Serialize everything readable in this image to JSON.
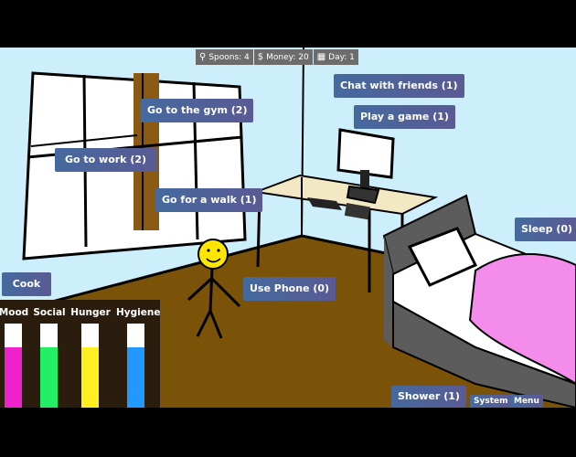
{
  "hud": {
    "spoons": "Spoons: 4",
    "money": "Money: 20",
    "day": "Day: 1"
  },
  "actions": {
    "chat": "Chat with friends (1)",
    "game": "Play a game (1)",
    "gym": "Go to the gym (2)",
    "work": "Go to work (2)",
    "walk": "Go for a walk (1)",
    "sleep": "Sleep (0)",
    "cook": "Cook",
    "phone": "Use Phone (0)",
    "shower": "Shower (1)",
    "system": "System",
    "menu": "Menu"
  },
  "stats": [
    {
      "label": "Mood",
      "color": "#ee22cc",
      "level": 0.72
    },
    {
      "label": "Social",
      "color": "#22ee66",
      "level": 0.72
    },
    {
      "label": "Hunger",
      "color": "#ffee22",
      "level": 0.72
    },
    {
      "label": "Hygiene",
      "color": "#2299ff",
      "level": 0.72
    }
  ]
}
